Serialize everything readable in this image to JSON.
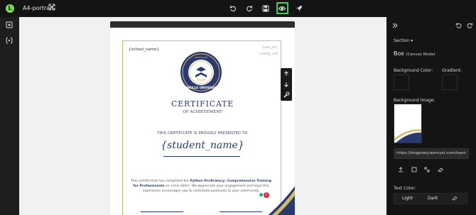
{
  "topbar": {
    "logo_letter": "L",
    "doc_title": "A4-portrait"
  },
  "certificate": {
    "school_placeholder": "{school_name}",
    "cert_id_placeholder": "{cert_id}",
    "cert_url_placeholder": "{verify_url}",
    "seal_text": "BOHOLLE UNIVERSITY",
    "seal_top_text": "CERTIFICATE",
    "title": "CERTIFICATE",
    "subtitle": "OF ACHIEVEMENT",
    "presented": "THIS CERTIFICATE IS PROUDLY PRESENTED TO",
    "student_placeholder": "{student_name}",
    "body_pre": "This certifie that has completed the ",
    "course": "Python Proficiency: Comprehensive Training for Professionals",
    "body_post": " on {end_date}. We appreciate your engagement and hope this experience encourages you to contribute positively to your community."
  },
  "badge_count": "1",
  "right_panel": {
    "section_label": "Section",
    "box_title": "Box",
    "box_mode": "(Canvas Mode)",
    "bg_color_label": "Background Color:",
    "gradient_label": "Gradient:",
    "bg_image_label": "Background Image:",
    "bg_image_url": "https://imgproxy.learnyst.com/learn",
    "text_color_label": "Text Color:",
    "theme_light": "Light",
    "theme_dark": "Dark"
  },
  "colors": {
    "accent_green": "#3ecf5a",
    "navy": "#2a3a6e",
    "gold": "#d4b96a"
  }
}
